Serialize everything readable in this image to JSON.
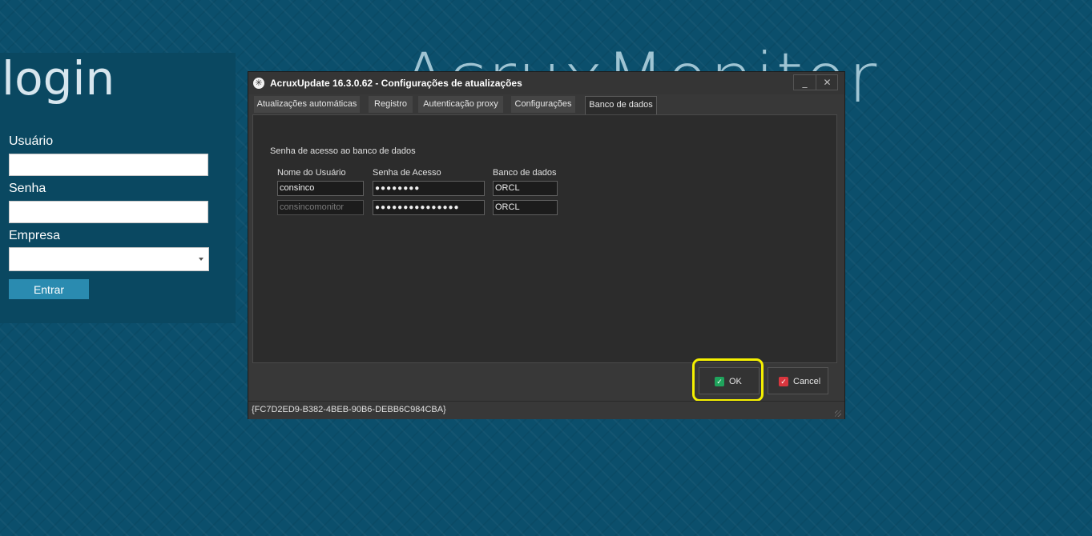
{
  "background": {
    "title": "AcruxMonitor"
  },
  "login": {
    "title": "login",
    "user_label": "Usuário",
    "password_label": "Senha",
    "company_label": "Empresa",
    "submit_label": "Entrar"
  },
  "dialog": {
    "title": "AcruxUpdate 16.3.0.62 - Configurações de atualizações",
    "window_buttons": {
      "minimize": "_",
      "close": "✕"
    },
    "tabs": [
      {
        "label": "Atualizações automáticas",
        "active": false
      },
      {
        "label": "Registro",
        "active": false
      },
      {
        "label": "Autenticação proxy",
        "active": false
      },
      {
        "label": "Configurações",
        "active": false
      },
      {
        "label": "Banco de dados",
        "active": true
      }
    ],
    "section_label": "Senha de acesso ao banco de dados",
    "columns": [
      "Nome do Usuário",
      "Senha de Acesso",
      "Banco de dados"
    ],
    "rows": [
      {
        "user": "consinco",
        "password": "●●●●●●●●",
        "database": "ORCL",
        "user_disabled": false
      },
      {
        "user": "consincomonitor",
        "password": "●●●●●●●●●●●●●●●",
        "database": "ORCL",
        "user_disabled": true
      }
    ],
    "ok_label": "OK",
    "cancel_label": "Cancel",
    "status_text": "{FC7D2ED9-B382-4BEB-90B6-DEBB6C984CBA}"
  },
  "colors": {
    "desktop_bg": "#0b4f6c",
    "dialog_bg": "#383838",
    "highlight": "#f5f000",
    "ok_check": "#1fa35c",
    "cancel_check": "#d9363e"
  }
}
